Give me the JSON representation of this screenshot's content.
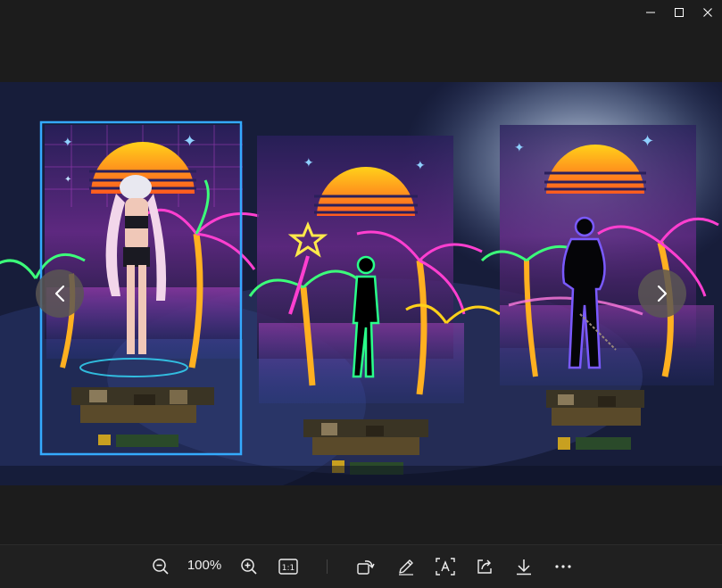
{
  "window": {
    "minimize_icon": "minimize-icon",
    "maximize_icon": "maximize-icon",
    "close_icon": "close-icon"
  },
  "viewer": {
    "prev_icon": "chevron-left-icon",
    "next_icon": "chevron-right-icon",
    "image_description": "Neon synthwave character selection: three panels with sunset, palm trees and characters"
  },
  "toolbar": {
    "zoom_level": "100%",
    "actual_size_label": "1:1",
    "icons": [
      "zoom-out-icon",
      "zoom-in-icon",
      "actual-size-icon",
      "rotate-icon",
      "edit-icon",
      "text-recognition-icon",
      "share-icon",
      "download-icon",
      "more-icon"
    ]
  },
  "colors": {
    "background": "#1c1c1c",
    "toolbar": "#202020",
    "neon_pink": "#ff3fd0",
    "neon_cyan": "#34e0ff",
    "sunset_orange": "#ff9a1f"
  }
}
